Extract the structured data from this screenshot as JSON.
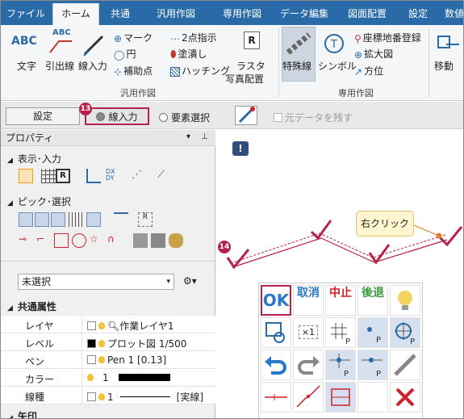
{
  "tabs": [
    "ファイル",
    "ホーム",
    "共通",
    "汎用作図",
    "専用作図",
    "データ編集",
    "図面配置",
    "設定",
    "数値"
  ],
  "active_tab": "ホーム",
  "ribbon": {
    "abc": "ABC",
    "bun": "文字",
    "hikidasen": "引出線",
    "hikidasen_abc": "ABC",
    "senyuryoku": "線入力",
    "mark": "マーク",
    "en": "円",
    "hojoten": "補助点",
    "niten": "2点指示",
    "nuri": "塗潰し",
    "hatching": "ハッチング",
    "raster_a": "ラスタ",
    "raster_b": "写真配置",
    "r_icon": "R",
    "tokushusen": "特殊線",
    "symbol": "シンボル",
    "zahyo": "座標地番登録",
    "kakudai": "拡大図",
    "hoi": "方位",
    "ido": "移動",
    "group1": "汎用作図",
    "group2": "専用作図"
  },
  "toolbar": {
    "settings": "設定",
    "line_input": "線入力",
    "elem_select": "要素選択",
    "keep_original": "元データを残す",
    "badge13": "13"
  },
  "panel": {
    "title": "プロパティ",
    "sec_display": "表示･入力",
    "sec_pick": "ピック･選択",
    "selection": "未選択",
    "common": "共通属性",
    "rows": [
      {
        "k": "レイヤ",
        "v": "作業レイヤ1"
      },
      {
        "k": "レベル",
        "v": "プロット図 1/500"
      },
      {
        "k": "ペン",
        "v": "Pen 1 [0.13]"
      },
      {
        "k": "カラー",
        "v": "1"
      },
      {
        "k": "線種",
        "v": "1",
        "v2": "[実線]"
      }
    ],
    "next": "矢印"
  },
  "canvas": {
    "right_click": "右クリック",
    "badge14": "14"
  },
  "pad": {
    "ok": "OK",
    "cancel": "取消",
    "stop": "中止",
    "back": "後退",
    "x1": "×1"
  },
  "colors": {
    "tab_bar": "#2a6aa8",
    "badge": "#b5224a",
    "accent": "#2f5f98",
    "ok_blue": "#2a78c8",
    "red": "#d0202a",
    "green": "#3a9a3a"
  }
}
